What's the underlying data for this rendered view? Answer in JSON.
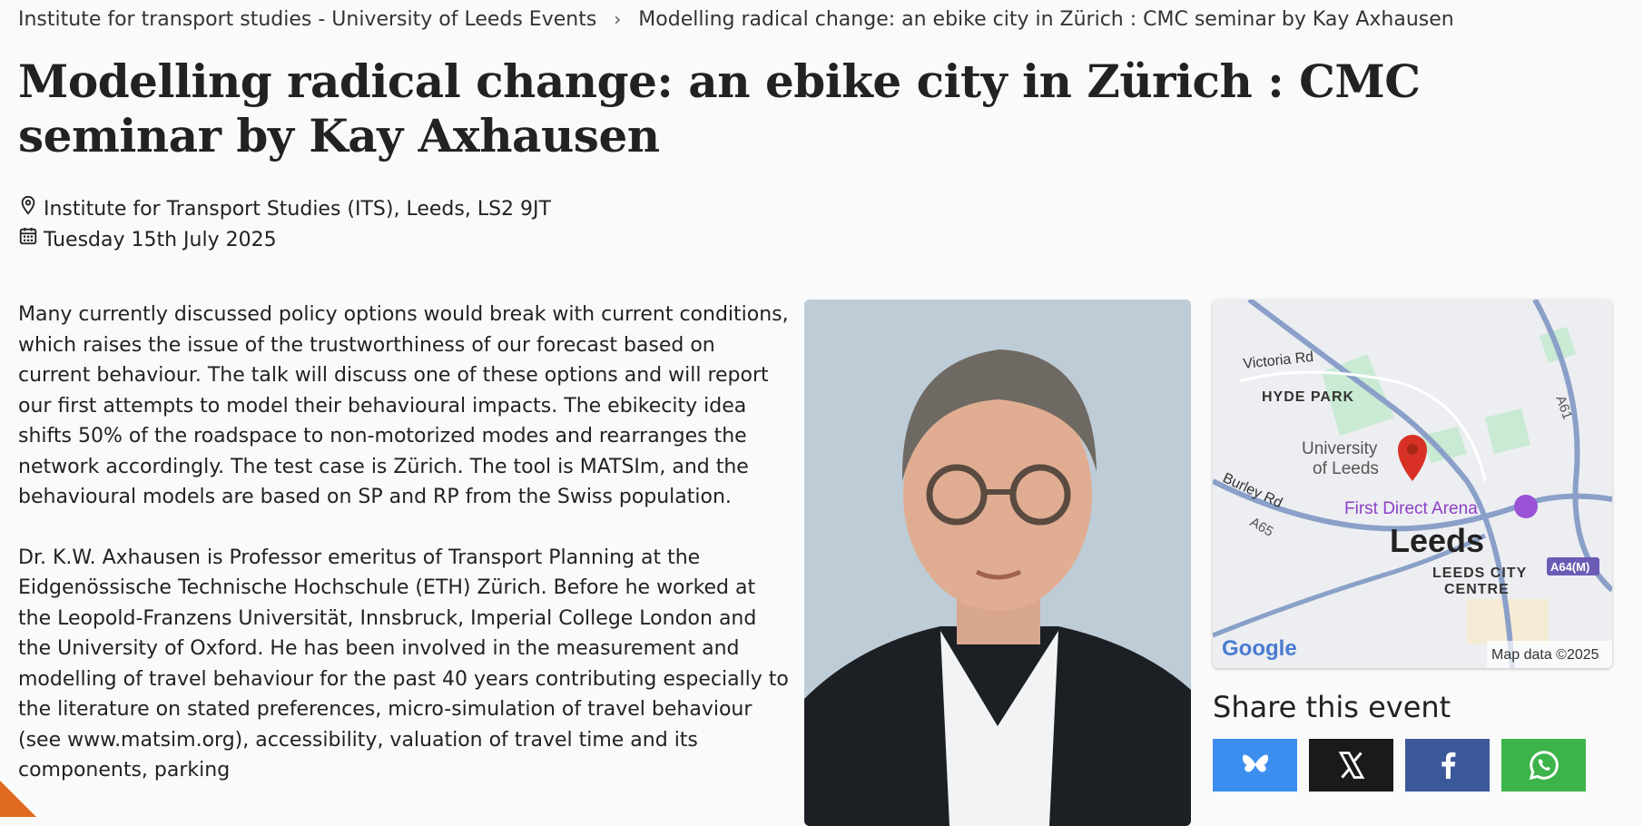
{
  "breadcrumb": {
    "items": [
      {
        "label": "Institute for transport studies - University of Leeds Events"
      },
      {
        "label": "Modelling radical change: an ebike city in Zürich : CMC seminar by Kay Axhausen"
      }
    ],
    "separator": "›"
  },
  "event": {
    "title": "Modelling radical change: an ebike city in Zürich : CMC seminar by Kay Axhausen",
    "location": "Institute for Transport Studies (ITS), Leeds, LS2 9JT",
    "date": "Tuesday 15th July 2025",
    "description": [
      "Many currently discussed policy options would break with current conditions, which raises the issue of the trustworthiness of our forecast based on current behaviour. The talk will discuss one of these options and will report our first attempts to model their behavioural impacts. The ebikecity idea shifts 50% of the roadspace to non-motorized modes and rearranges the network accordingly. The test case is Zürich. The tool is MATSIm, and the behavioural models are based on SP and RP from the Swiss population.",
      "Dr. K.W. Axhausen is Professor emeritus of Transport Planning at the Eidgenössische Technische Hochschule (ETH) Zürich. Before he worked at the Leopold-Franzens Universität, Innsbruck, Imperial College London and the University of Oxford. He has been involved in the measurement and modelling of travel behaviour for the past 40 years contributing especially to the literature on stated preferences, micro-simulation of travel behaviour (see www.matsim.org), accessibility, valuation of travel time and its components, parking"
    ]
  },
  "map": {
    "labels": {
      "victoria_rd": "Victoria Rd",
      "hyde_park": "HYDE PARK",
      "university_1": "University",
      "university_2": "of Leeds",
      "burley_rd": "Burley Rd",
      "a65": "A65",
      "a61": "A61",
      "first_direct": "First Direct Arena",
      "leeds": "Leeds",
      "city_centre_1": "LEEDS CITY",
      "city_centre_2": "CENTRE",
      "a64": "A64(M)",
      "google": "Google",
      "map_data": "Map data ©2025"
    }
  },
  "share": {
    "title": "Share this event",
    "buttons": [
      {
        "name": "bluesky",
        "color": "#3b8ef0"
      },
      {
        "name": "x",
        "color": "#1a1a1a"
      },
      {
        "name": "facebook",
        "color": "#3b5998"
      },
      {
        "name": "whatsapp",
        "color": "#3cb44a"
      }
    ]
  }
}
